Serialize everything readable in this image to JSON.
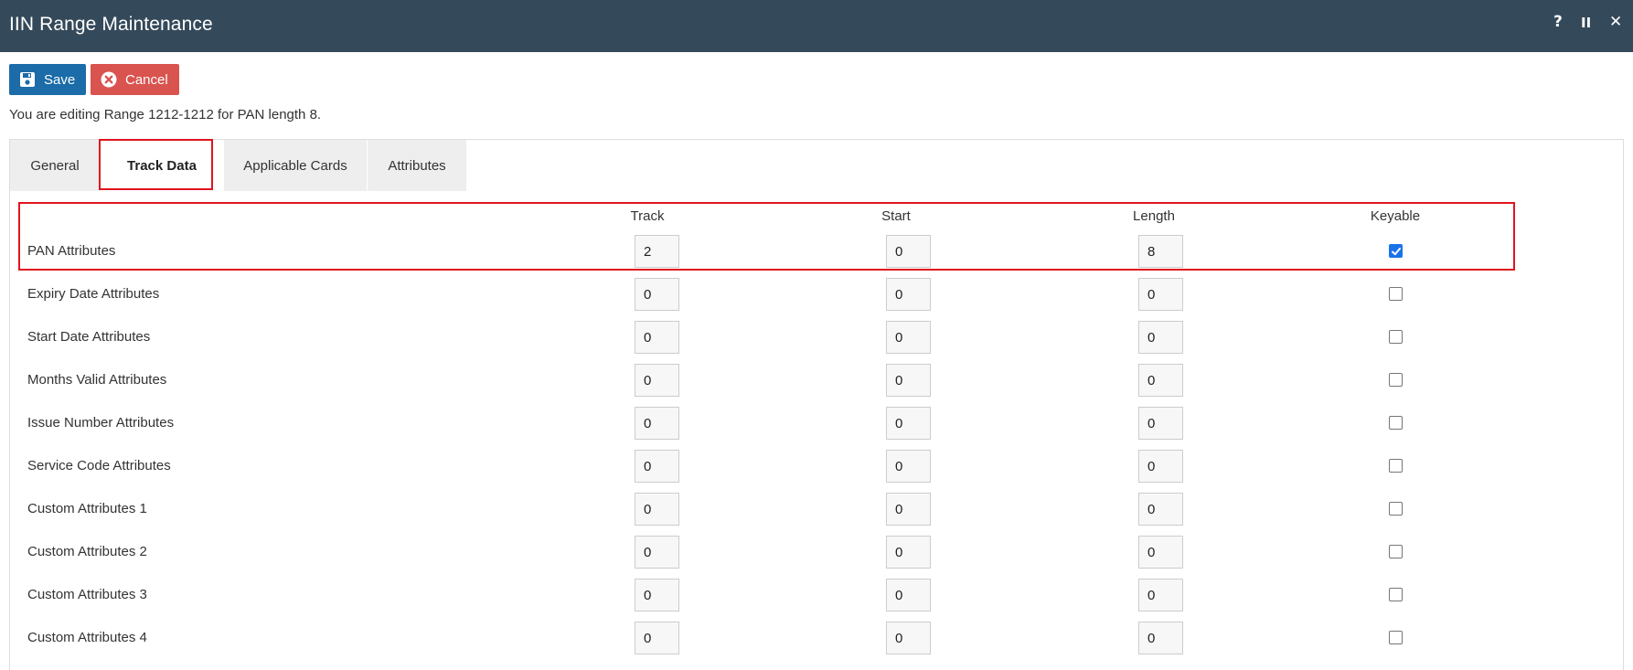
{
  "window": {
    "title": "IIN Range Maintenance",
    "controls": {
      "help": "?",
      "pause": "II",
      "close": "✕"
    }
  },
  "toolbar": {
    "save_label": "Save",
    "cancel_label": "Cancel"
  },
  "info_text": "You are editing Range 1212-1212 for PAN length 8.",
  "tabs": [
    {
      "label": "General",
      "active": false
    },
    {
      "label": "Track Data",
      "active": true
    },
    {
      "label": "Applicable Cards",
      "active": false
    },
    {
      "label": "Attributes",
      "active": false
    }
  ],
  "table": {
    "headers": {
      "track": "Track",
      "start": "Start",
      "length": "Length",
      "keyable": "Keyable"
    },
    "rows": [
      {
        "label": "PAN Attributes",
        "track": "2",
        "start": "0",
        "length": "8",
        "keyable": true
      },
      {
        "label": "Expiry Date Attributes",
        "track": "0",
        "start": "0",
        "length": "0",
        "keyable": false
      },
      {
        "label": "Start Date Attributes",
        "track": "0",
        "start": "0",
        "length": "0",
        "keyable": false
      },
      {
        "label": "Months Valid Attributes",
        "track": "0",
        "start": "0",
        "length": "0",
        "keyable": false
      },
      {
        "label": "Issue Number Attributes",
        "track": "0",
        "start": "0",
        "length": "0",
        "keyable": false
      },
      {
        "label": "Service Code Attributes",
        "track": "0",
        "start": "0",
        "length": "0",
        "keyable": false
      },
      {
        "label": "Custom Attributes 1",
        "track": "0",
        "start": "0",
        "length": "0",
        "keyable": false
      },
      {
        "label": "Custom Attributes 2",
        "track": "0",
        "start": "0",
        "length": "0",
        "keyable": false
      },
      {
        "label": "Custom Attributes 3",
        "track": "0",
        "start": "0",
        "length": "0",
        "keyable": false
      },
      {
        "label": "Custom Attributes 4",
        "track": "0",
        "start": "0",
        "length": "0",
        "keyable": false
      }
    ]
  },
  "colors": {
    "titlebar": "#34495a",
    "save_button": "#1b6ca8",
    "cancel_button": "#d9534f",
    "highlight": "#e0141e",
    "checkbox_checked": "#1a73e8"
  }
}
